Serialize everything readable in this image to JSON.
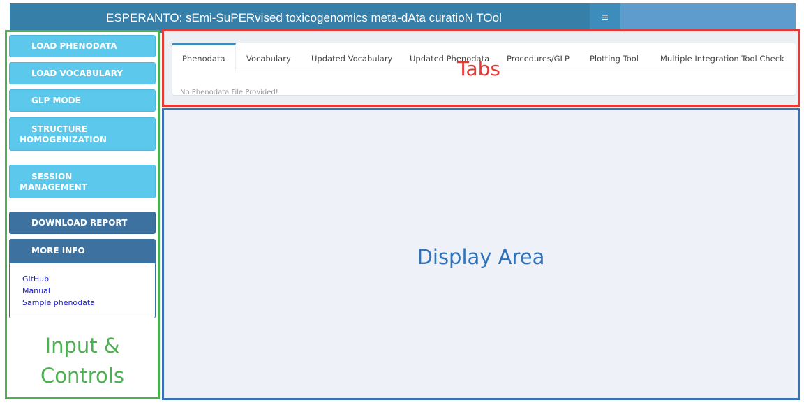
{
  "header": {
    "title": "ESPERANTO: sEmi-SuPERvised toxicogenomics meta-dAta curatioN TOol",
    "menu_icon": "hamburger-icon",
    "menu_glyph": "≡"
  },
  "sidebar": {
    "buttons": [
      {
        "label": "LOAD PHENODATA"
      },
      {
        "label": "LOAD VOCABULARY"
      },
      {
        "label": "GLP MODE"
      },
      {
        "line1": "STRUCTURE",
        "line2": "HOMOGENIZATION"
      },
      {
        "line1": "SESSION",
        "line2": "MANAGEMENT"
      }
    ],
    "download_report": "DOWNLOAD REPORT",
    "more_info": {
      "title": "MORE INFO",
      "links": [
        "GitHub",
        "Manual",
        "Sample phenodata"
      ]
    }
  },
  "tabs": {
    "items": [
      {
        "label": "Phenodata"
      },
      {
        "label": "Vocabulary"
      },
      {
        "label": "Updated Vocabulary"
      },
      {
        "label": "Updated Phenodata"
      },
      {
        "label": "Procedures/GLP"
      },
      {
        "label": "Plotting Tool"
      },
      {
        "label": "Multiple Integration Tool Check"
      }
    ],
    "active": "Phenodata",
    "content_message": "No Phenodata File Provided!"
  },
  "annotations": {
    "input_controls_line1": "Input &",
    "input_controls_line2": "Controls",
    "tabs": "Tabs",
    "display_area": "Display Area"
  },
  "colors": {
    "header_brand": "#367fa9",
    "header_bar": "#3c8dbc",
    "sidebar_button": "#5bc8ec",
    "sidebar_button_dark": "#3d72a0",
    "annotation_green": "#4caf50",
    "annotation_red": "#e53935",
    "annotation_blue": "#2f73bd"
  }
}
